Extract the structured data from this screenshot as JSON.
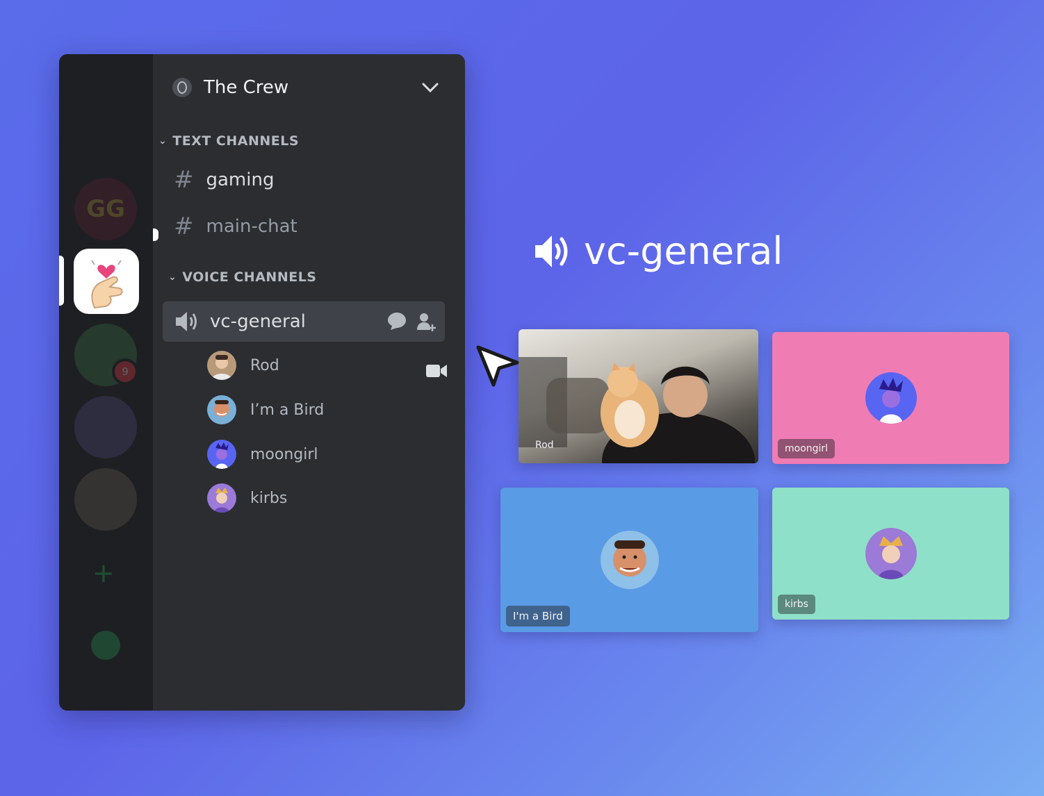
{
  "server": {
    "name": "The Crew"
  },
  "categories": {
    "text": "TEXT CHANNELS",
    "voice": "VOICE CHANNELS"
  },
  "text_channels": [
    {
      "name": "gaming",
      "unread": true
    },
    {
      "name": "main-chat",
      "unread": false
    }
  ],
  "voice_channel": {
    "name": "vc-general"
  },
  "rail": {
    "mention_count": "9"
  },
  "voice_users": [
    {
      "name": "Rod",
      "camera_on": true,
      "color": "#b89a7a"
    },
    {
      "name": "I’m a Bird",
      "camera_on": false,
      "color": "#c98a6a"
    },
    {
      "name": "moongirl",
      "camera_on": false,
      "color": "#5865f2"
    },
    {
      "name": "kirbs",
      "camera_on": false,
      "color": "#9b7ad8"
    }
  ],
  "stage": {
    "title": "vc-general",
    "tiles": [
      {
        "name": "Rod",
        "bg": "#4a4a4a"
      },
      {
        "name": "moongirl",
        "bg": "#f07cb4"
      },
      {
        "name": "I'm a Bird",
        "bg": "#5a9be6"
      },
      {
        "name": "kirbs",
        "bg": "#8fe0c8"
      }
    ]
  },
  "colors": {
    "accent": "#5865f2",
    "rail": "#1e1f22",
    "sidebar": "#2b2d31",
    "selected": "#404249"
  }
}
